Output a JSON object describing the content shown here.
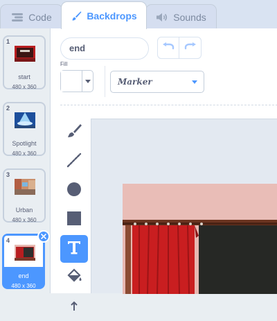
{
  "tabs": [
    {
      "label": "Code",
      "icon": "code-icon"
    },
    {
      "label": "Backdrops",
      "icon": "brush-icon",
      "active": true
    },
    {
      "label": "Sounds",
      "icon": "speaker-icon"
    }
  ],
  "backdrops": [
    {
      "number": "1",
      "name": "start",
      "size": "480 x 360"
    },
    {
      "number": "2",
      "name": "Spotlight",
      "size": "480 x 360"
    },
    {
      "number": "3",
      "name": "Urban",
      "size": "480 x 360"
    },
    {
      "number": "4",
      "name": "end",
      "size": "480 x 360",
      "selected": true
    }
  ],
  "editor": {
    "costume_name": "end",
    "fill_label": "Fill",
    "fill_color": "#ffffff",
    "font": "Marker"
  },
  "tools": [
    "brush-icon",
    "line-icon",
    "circle-icon",
    "rectangle-icon",
    "text-icon",
    "fill-icon"
  ],
  "colors": {
    "accent": "#4c97ff",
    "text": "#575e75"
  }
}
